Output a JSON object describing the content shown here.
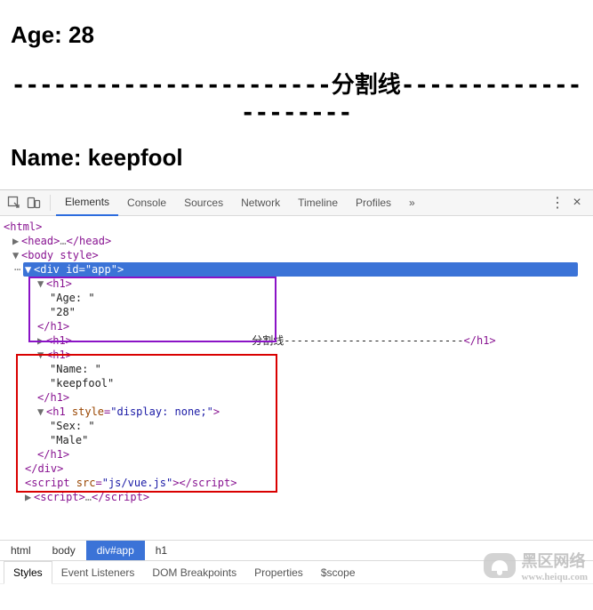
{
  "page": {
    "h1_age": "Age: 28",
    "divider_left": "-----------------------",
    "divider_label": "分割线",
    "divider_right": "---------------------",
    "h1_name": "Name: keepfool"
  },
  "devtools": {
    "tabs": [
      "Elements",
      "Console",
      "Sources",
      "Network",
      "Timeline",
      "Profiles"
    ],
    "overflow": "»",
    "close": "×",
    "dom": {
      "html_open": "<html>",
      "head": {
        "open": "<head>",
        "ell": "…",
        "close": "</head>"
      },
      "body_open": "<body style>",
      "div_open": [
        "<div ",
        "id",
        "=",
        "\"app\"",
        ">"
      ],
      "h1a": {
        "open": "<h1>",
        "t1": "\"Age: \"",
        "t2": "\"28\"",
        "close": "</h1>"
      },
      "h1divider": {
        "open": "<h1>",
        "dashes_l": "----------------------------",
        "dashes_r": "----------------------------",
        "txt": "分割线",
        "close": "</h1>"
      },
      "h1b": {
        "open": "<h1>",
        "t1": "\"Name: \"",
        "t2": "\"keepfool\"",
        "close": "</h1>"
      },
      "h1c": {
        "open": [
          "<h1 ",
          "style",
          "=",
          "\"display: none;\"",
          ">"
        ],
        "t1": "\"Sex: \"",
        "t2": "\"Male\"",
        "close": "</h1>"
      },
      "div_close": "</div>",
      "script1": [
        "<script ",
        "src",
        "=",
        "\"js/vue.js\"",
        ">",
        "</script>"
      ],
      "script2": {
        "open": "<script>",
        "ell": "…",
        "close": "</script>"
      }
    },
    "breadcrumb": [
      "html",
      "body",
      "div#app",
      "h1"
    ],
    "subtabs": [
      "Styles",
      "Event Listeners",
      "DOM Breakpoints",
      "Properties",
      "$scope"
    ]
  },
  "watermark": {
    "line1": "黑区网络",
    "line2": "www.heiqu.com"
  }
}
